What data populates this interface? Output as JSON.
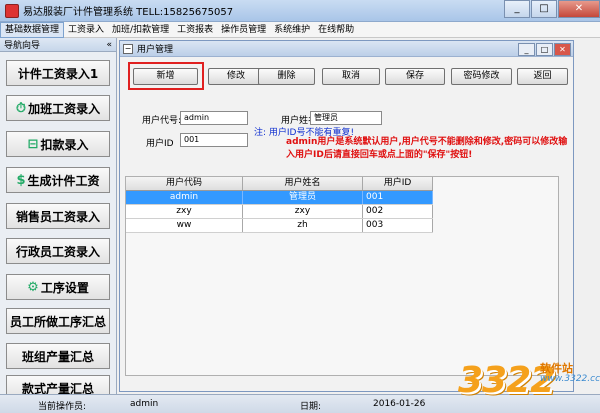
{
  "window": {
    "title": "易达服装厂计件管理系统  TELL:15825675057"
  },
  "menubar": {
    "items": [
      "基础数据管理",
      "工资录入",
      "加班/扣款管理",
      "工资报表",
      "操作员管理",
      "系统维护",
      "在线帮助"
    ]
  },
  "nav": {
    "header": "导航向导",
    "collapse": "«",
    "items": [
      "计件工资录入1",
      "加班工资录入",
      "扣款录入",
      "生成计件工资",
      "销售员工资录入",
      "行政员工资录入",
      "工序设置",
      "员工所做工序汇总",
      "班组产量汇总",
      "款式产量汇总"
    ]
  },
  "child": {
    "title": "用户管理",
    "toolbar": [
      "新增",
      "修改",
      "删除",
      "取消",
      "保存",
      "密码修改",
      "返回"
    ],
    "form": {
      "user_code_label": "用户代号:",
      "user_code_value": "admin",
      "user_name_label": "用户姓名:",
      "user_name_value": "管理员",
      "user_id_label": "用户ID",
      "user_id_value": "001"
    },
    "note_blue": "注: 用户ID号不能有重复!",
    "note_red": "admin用户是系统默认用户,用户代号不能删除和修改,密码可以修改输入用户ID后请直接回车或点上面的\"保存\"按钮!"
  },
  "grid": {
    "headers": [
      "用户代码",
      "用户姓名",
      "用户ID"
    ],
    "rows": [
      [
        "admin",
        "管理员",
        "001"
      ],
      [
        "zxy",
        "zxy",
        "002"
      ],
      [
        "ww",
        "zh",
        "003"
      ]
    ]
  },
  "status": {
    "operator_label": "当前操作员:",
    "operator": "admin",
    "date_label": "日期:",
    "date": "2016-01-26"
  },
  "watermark": {
    "number": "3322",
    "cn": "软件站",
    "url": "www.3322.cc"
  },
  "colors": {
    "selection": "#3399ff",
    "note_red": "#e01010",
    "note_blue": "#1030d0",
    "highlight": "#e02020"
  }
}
